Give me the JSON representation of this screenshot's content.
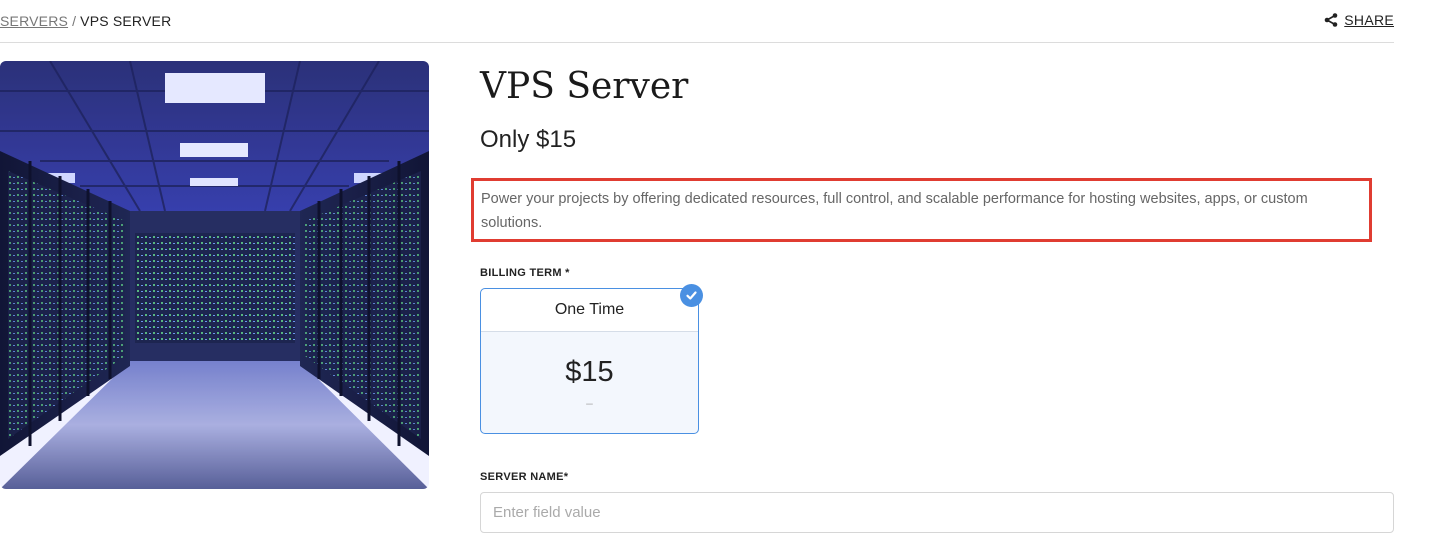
{
  "breadcrumb": {
    "parent": "SERVERS",
    "separator": "/",
    "current": "VPS SERVER"
  },
  "share": {
    "label": "SHARE",
    "icon": "share-icon"
  },
  "product": {
    "image_alt": "server-room-image",
    "title": "VPS Server",
    "price_line": "Only $15",
    "description": "Power your projects by offering dedicated resources, full control, and scalable performance for hosting websites, apps, or custom solutions."
  },
  "billing": {
    "label": "BILLING TERM *",
    "selected_term": {
      "name": "One Time",
      "price": "$15",
      "sub": "–",
      "selected": true,
      "icon": "checkmark-icon"
    }
  },
  "server_name": {
    "label": "SERVER NAME*",
    "value": "",
    "placeholder": "Enter field value"
  },
  "colors": {
    "accent": "#4a90e2",
    "highlight_border": "#e03c31",
    "selected_card_bg": "#f3f7fd"
  }
}
